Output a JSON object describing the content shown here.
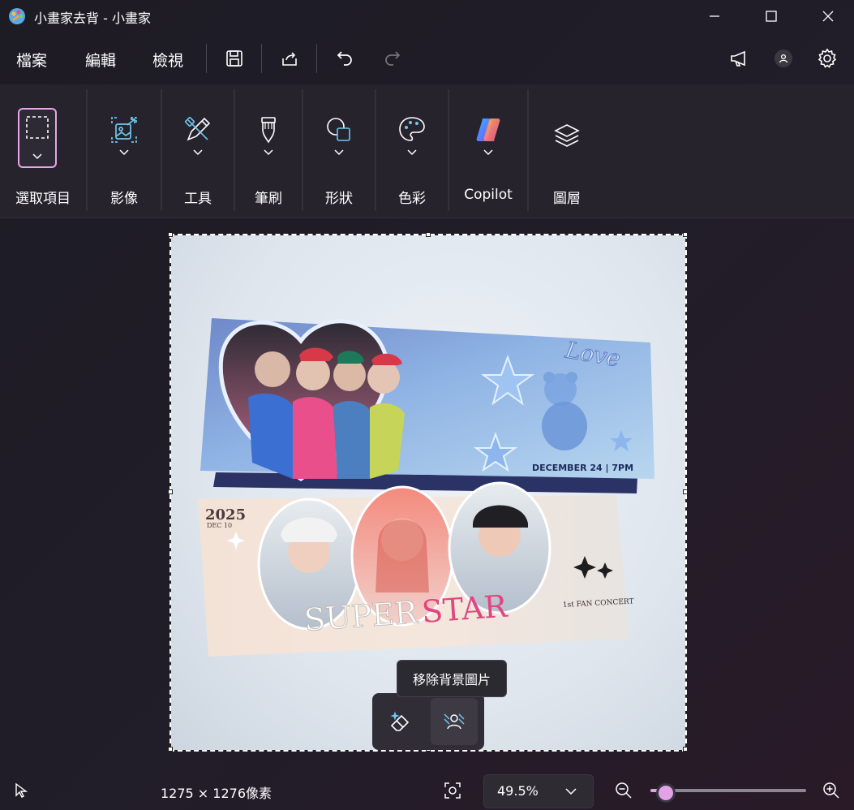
{
  "window": {
    "title": "小畫家去背 - 小畫家",
    "icon": "paint-palette-icon",
    "controls": [
      "minimize-icon",
      "maximize-icon",
      "close-icon"
    ]
  },
  "menu": {
    "file": "檔案",
    "edit": "編輯",
    "view": "檢視",
    "icons": [
      "save-icon",
      "share-icon",
      "undo-icon",
      "redo-icon",
      "announcement-icon",
      "account-icon",
      "settings-icon"
    ]
  },
  "ribbon": {
    "selection": "選取項目",
    "image": "影像",
    "tools": "工具",
    "brushes": "筆刷",
    "shapes": "形狀",
    "colors": "色彩",
    "copilot": "Copilot",
    "layers": "圖層"
  },
  "canvas": {
    "ticket_top": {
      "script_text": "Love",
      "date_text": "DECEMBER 24 | 7PM"
    },
    "ticket_bottom": {
      "year": "2025",
      "date": "DEC 10",
      "title_part1": "SUPER",
      "title_part2": "STAR",
      "subtitle": "1st FAN CONCERT"
    }
  },
  "floating_toolbar": {
    "tooltip": "移除背景圖片",
    "buttons": [
      "generative-erase-icon",
      "remove-background-icon"
    ]
  },
  "status": {
    "image_size": "1275 × 1276像素",
    "zoom": "49.5%",
    "zoom_level": 0.1
  },
  "colors": {
    "accent": "#e1a3e6",
    "background": "#1f1c26",
    "ribbon": "#26232d"
  }
}
